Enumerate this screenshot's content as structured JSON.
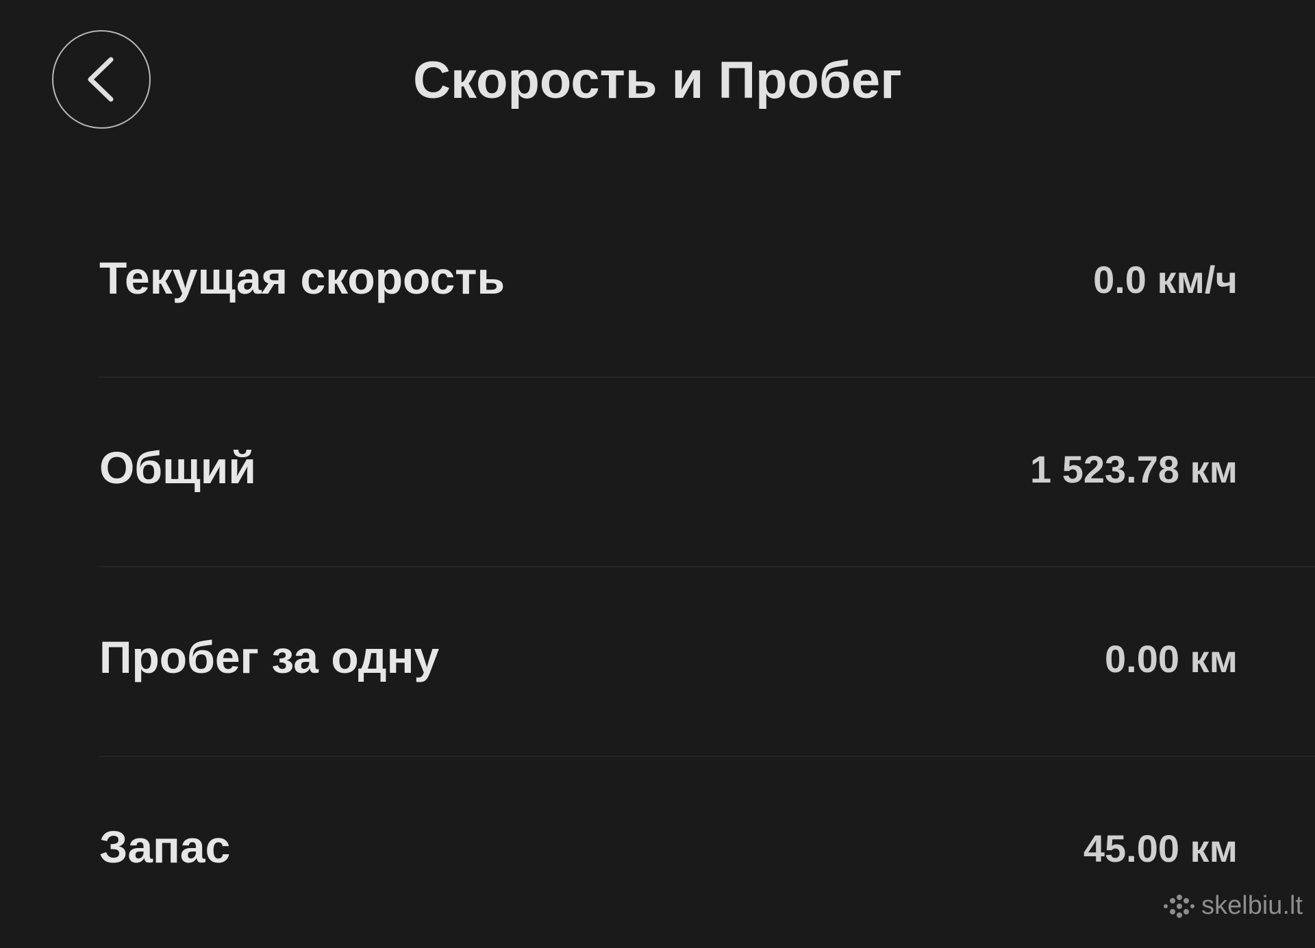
{
  "header": {
    "title": "Скорость и Пробег",
    "back_icon": "chevron-left-icon"
  },
  "rows": [
    {
      "label": "Текущая скорость",
      "value": "0.0 км/ч"
    },
    {
      "label": "Общий",
      "value": "1 523.78 км"
    },
    {
      "label": "Пробег за одну",
      "value": "0.00 км"
    },
    {
      "label": "Запас",
      "value": "45.00 км"
    }
  ],
  "watermark": {
    "text": "skelbiu.lt",
    "icon": "dots-logo-icon"
  },
  "colors": {
    "background": "#1a1a1a",
    "text": "#e4e4e4",
    "divider": "#262626"
  }
}
